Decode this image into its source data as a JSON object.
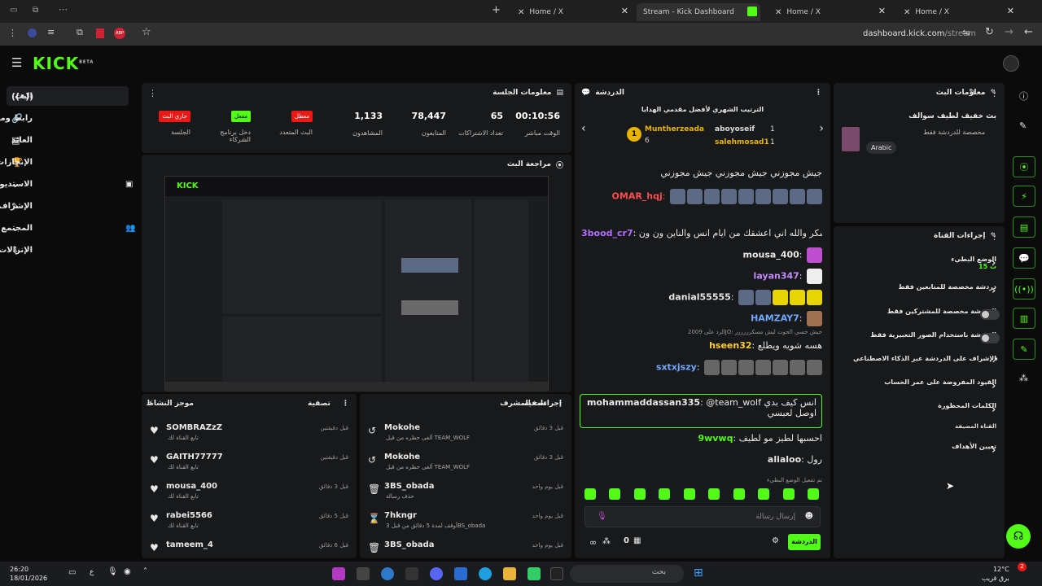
{
  "browser": {
    "tabs": [
      {
        "label": "Home / X"
      },
      {
        "label": "Stream - Kick Dashboard"
      },
      {
        "label": "Home / X"
      },
      {
        "label": "Home / X"
      }
    ],
    "url_host": "dashboard.kick.com",
    "url_path": "/stream"
  },
  "brand": {
    "logo": "KICK",
    "beta": "BETA",
    "accent": "#53fc18"
  },
  "nav": {
    "items": [
      {
        "label": "البث",
        "icon": "broadcast-icon"
      },
      {
        "label": "رابط ومفتاح البث",
        "icon": "link-icon"
      },
      {
        "label": "العائد",
        "icon": "dollar-icon"
      },
      {
        "label": "الإنجازات",
        "icon": "trophy-icon"
      },
      {
        "label": "الاستديو",
        "icon": "studio-icon"
      },
      {
        "label": "الإشراف",
        "icon": "wrench-icon"
      },
      {
        "label": "المجتمع",
        "icon": "community-icon"
      },
      {
        "label": "الإنزالات و الجوائز",
        "icon": "drop-icon"
      }
    ]
  },
  "session": {
    "title": "معلومات الجلسة",
    "stats": [
      {
        "value": "00:10:56",
        "label": "الوقت مباشر"
      },
      {
        "value": "65",
        "label": "تعداد الاشتراكات"
      },
      {
        "value": "78,447",
        "label": "المتابعون"
      },
      {
        "value": "1,133",
        "label": "المشاهدون"
      }
    ],
    "badges": [
      {
        "badge": "معطل",
        "label": "البث المتعدد",
        "color": "#e91916"
      },
      {
        "badge": "مفعل",
        "label": "دخل برنامج الشركاء",
        "color": "#53fc18"
      },
      {
        "badge": "جاري البث",
        "label": "الجلسة",
        "color": "#e91916"
      }
    ]
  },
  "preview": {
    "title": "مراجعة البث"
  },
  "activity": {
    "title": "موجز النشاط",
    "filter": "تصفية",
    "items": [
      {
        "name": "SOMBRAZzZ",
        "sub": "تابع القناة لك",
        "time": "قبل دقيقتين"
      },
      {
        "name": "GAITH77777",
        "sub": "تابع القناة لك",
        "time": "قبل دقيقتين"
      },
      {
        "name": "mousa_400",
        "sub": "تابع القناة لك",
        "time": "قبل 3 دقائق"
      },
      {
        "name": "rabei5566",
        "sub": "تابع القناة لك",
        "time": "قبل 5 دقائق"
      },
      {
        "name": "tameem_4",
        "sub": "تابع القناة لك",
        "time": "قبل 6 دقائق"
      }
    ]
  },
  "modactions": {
    "title": "إجراءات المشرف",
    "filter": "تصفية",
    "items": [
      {
        "name": "Mokohe",
        "sub": "ألغى حظره من قبل TEAM_WOLF",
        "time": "قبل 3 دقائق",
        "icon": "undo-icon"
      },
      {
        "name": "Mokohe",
        "sub": "ألغى حظره من قبل TEAM_WOLF",
        "time": "قبل 3 دقائق",
        "icon": "undo-icon"
      },
      {
        "name": "3BS_obada",
        "sub": "حذف رسالة",
        "time": "قبل يوم واحد",
        "icon": "trash-icon"
      },
      {
        "name": "7hkngr",
        "sub": "أوقف لمدة 5 دقائق من قبل 3BS_obada",
        "time": "قبل يوم واحد",
        "icon": "hourglass-icon"
      },
      {
        "name": "3BS_obada",
        "sub": "حذف رسالة",
        "time": "قبل يوم واحد",
        "icon": "trash-icon"
      }
    ]
  },
  "chat": {
    "title": "الدردشة",
    "leaderboard_title": "الترتيب الشهري لأفضل مقدمي الهدايا",
    "leaders": [
      {
        "name": "Muntherzeada",
        "count": "6",
        "rank": "1"
      },
      {
        "name": "aboyoseif",
        "count": "1"
      },
      {
        "name": "salehmosad1",
        "count": "1"
      }
    ],
    "messages": [
      {
        "user": "",
        "text": "جيش مجوزني جيش مجوزني جيش مجوزني",
        "color": "#ffffff"
      },
      {
        "user": "OMAR_hqj",
        "text": "",
        "color": "#ff4d4d"
      },
      {
        "user": "3bood_cr7",
        "text": "اوسكر والله اني اعشقك من ايام انس والناين ون ون",
        "color": "#b36cff"
      },
      {
        "user": "mousa_400",
        "text": "",
        "color": "#ffffff"
      },
      {
        "user": "layan347",
        "text": "",
        "color": "#c48cff"
      },
      {
        "user": "danial55555",
        "text": "",
        "color": "#ffffff"
      },
      {
        "user": "HAMZAY7",
        "text": "",
        "color": "#6fa8ff"
      },
      {
        "user": "hseen32",
        "text": "هسه شويه ويطلع",
        "color": "#ffcc33"
      },
      {
        "user": "sxtxjszy",
        "text": "",
        "color": "#6fa8ff"
      },
      {
        "user": "mohammaddassan335",
        "text": "@team_wolf انس كيف بدي اوصل لعبسي",
        "color": "#ffffff"
      },
      {
        "user": "9wvwq",
        "text": "احسبها لطيز مو لطيف",
        "color": "#53fc18"
      },
      {
        "user": "alialoo",
        "text": "رول",
        "color": "#ffffff"
      }
    ],
    "reply_note": "الرد على 2009JO: جيش جسي الحوت ليش مسكرررررر",
    "slow_mode": "تم تفعيل الوضع البطيء",
    "input_placeholder": "إرسال رسالة",
    "send_label": "الدردشة",
    "count": "0"
  },
  "streaminfo": {
    "title": "معلومات البث",
    "stream_title": "بث خفيف لطيف سوالف",
    "category": "مخصصة للدردشة فقط",
    "tag": "Arabic"
  },
  "channelactions": {
    "title": "إجراءات القناة",
    "rows": [
      {
        "label": "الوضع البطيء",
        "sub": "15 ث",
        "type": "chevron"
      },
      {
        "label": "دردشة مخصصة للمتابعين فقط",
        "type": "chevron"
      },
      {
        "label": "الدردشة مخصصة للمشتركين فقط",
        "type": "toggle"
      },
      {
        "label": "الدردشة باستخدام الصور التعبيرية فقط",
        "type": "toggle"
      },
      {
        "label": "الإشراف على الدردشة عبر الذكاء الاصطناعي",
        "type": "link"
      },
      {
        "label": "القيود المفروضة على عمر الحساب",
        "type": "chevron"
      },
      {
        "label": "الكلمات المحظورة",
        "type": "chevron"
      }
    ],
    "section": "القناة المضيفة",
    "target": "تعيين الأهداف"
  },
  "taskbar": {
    "time": "26:20",
    "date": "18/01/2026",
    "lang": "ع",
    "search": "بحث",
    "temp": "12°C",
    "weather": "برق قريب",
    "notif": "2"
  }
}
